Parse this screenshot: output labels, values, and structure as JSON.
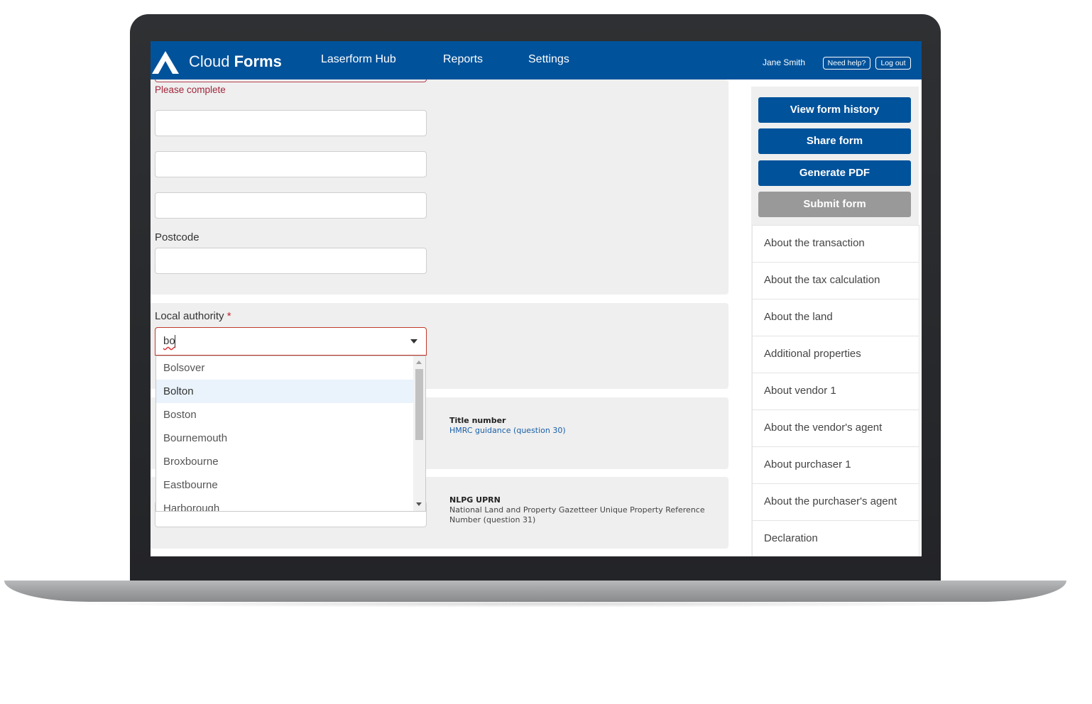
{
  "header": {
    "brand_light": "Cloud",
    "brand_bold": "Forms",
    "nav": [
      "Laserform Hub",
      "Reports",
      "Settings"
    ],
    "user_name": "Jane Smith",
    "help_label": "Need help?",
    "logout_label": "Log out",
    "logo_icon": "mountain-a-logo-icon"
  },
  "form": {
    "error_text": "Please complete",
    "postcode_label": "Postcode",
    "local_authority_label": "Local authority",
    "required_marker": "*",
    "local_authority_value": "bo",
    "dropdown_options": [
      "Bolsover",
      "Bolton",
      "Boston",
      "Bournemouth",
      "Broxbourne",
      "Eastbourne",
      "Harborough"
    ],
    "highlighted_option": "Bolton",
    "title_number_label": "Title number",
    "title_number_link": "HMRC guidance (question 30)",
    "nlpg_label": "NLPG UPRN",
    "nlpg_desc": "National Land and Property Gazetteer Unique Property Reference Number (question 31)"
  },
  "sidebar": {
    "buttons": {
      "history": "View form history",
      "share": "Share form",
      "pdf": "Generate PDF",
      "submit": "Submit form"
    },
    "sections": [
      "About the transaction",
      "About the tax calculation",
      "About the land",
      "Additional properties",
      "About vendor 1",
      "About the vendor's agent",
      "About purchaser 1",
      "About the purchaser's agent",
      "Declaration"
    ]
  },
  "colors": {
    "brand_blue": "#00529b",
    "error_red": "#a1263a",
    "disabled_gray": "#999999",
    "link_blue": "#1a5fa8"
  }
}
